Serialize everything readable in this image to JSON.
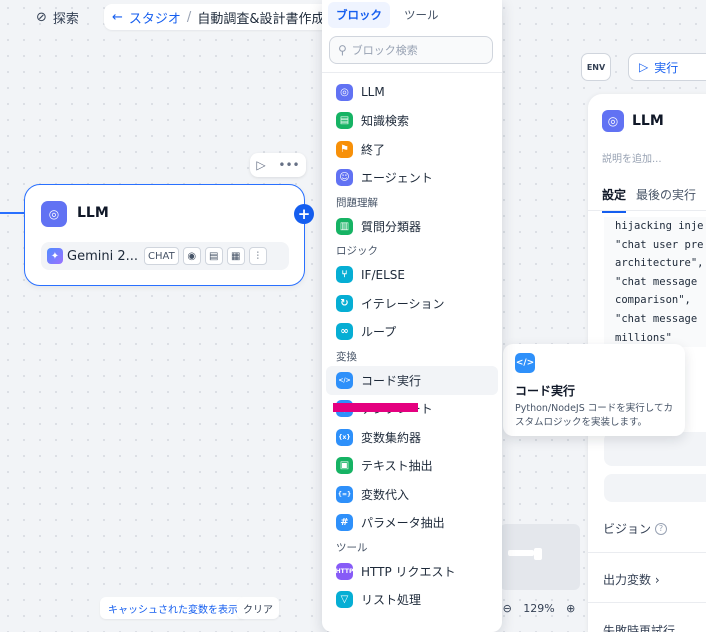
{
  "topbar": {
    "search_label": "探索",
    "studio_label": "スタジオ",
    "separator": "/",
    "app_title": "自動調査&設計書作成"
  },
  "node": {
    "title": "LLM",
    "model_name": "Gemini 2...",
    "mode_chip": "CHAT"
  },
  "canvas": {
    "cache_button": "キャッシュされた変数を表示",
    "clear_button": "クリア",
    "zoom_level": "129%"
  },
  "toolbar": {
    "env_label": "ENV",
    "run_label": "実行"
  },
  "panel": {
    "title": "LLM",
    "description_placeholder": "説明を追加...",
    "tabs": [
      "設定",
      "最後の実行"
    ],
    "code_lines": [
      "hijacking inje",
      "\"chat user pre",
      "architecture\",",
      "\"chat message",
      "comparison\",",
      "\"chat message",
      "millions\""
    ],
    "vision_label": "ビジョン",
    "output_vars_label": "出力変数",
    "truncated_label": "失敗時再試行"
  },
  "tooltip": {
    "title": "コード実行",
    "description": "Python/NodeJS コードを実行してカスタムロジックを実装します。"
  },
  "dropdown": {
    "tabs": [
      "ブロック",
      "ツール"
    ],
    "search_placeholder": "ブロック検索",
    "items": [
      {
        "type": "item",
        "label": "LLM",
        "icon": "llm-icon",
        "color": "#6172f3",
        "glyph": "◎"
      },
      {
        "type": "item",
        "label": "知識検索",
        "icon": "knowledge-icon",
        "color": "#16b364",
        "glyph": "▤"
      },
      {
        "type": "item",
        "label": "終了",
        "icon": "end-icon",
        "color": "#f79009",
        "glyph": "⚑"
      },
      {
        "type": "item",
        "label": "エージェント",
        "icon": "agent-icon",
        "color": "#6172f3",
        "glyph": "☺"
      },
      {
        "type": "group",
        "label": "問題理解"
      },
      {
        "type": "item",
        "label": "質問分類器",
        "icon": "classifier-icon",
        "color": "#16b364",
        "glyph": "▥"
      },
      {
        "type": "group",
        "label": "ロジック"
      },
      {
        "type": "item",
        "label": "IF/ELSE",
        "icon": "branch-icon",
        "color": "#06aed4",
        "glyph": "⑂"
      },
      {
        "type": "item",
        "label": "イテレーション",
        "icon": "iteration-icon",
        "color": "#06aed4",
        "glyph": "↻"
      },
      {
        "type": "item",
        "label": "ループ",
        "icon": "loop-icon",
        "color": "#06aed4",
        "glyph": "∞"
      },
      {
        "type": "group",
        "label": "変換"
      },
      {
        "type": "item",
        "label": "コード実行",
        "icon": "code-icon",
        "color": "#2e90fa",
        "glyph": "</>",
        "hover": true
      },
      {
        "type": "item",
        "label": "テンプレート",
        "icon": "template-icon",
        "color": "#2e90fa",
        "glyph": "◐"
      },
      {
        "type": "item",
        "label": "変数集約器",
        "icon": "variable-aggregator-icon",
        "color": "#2e90fa",
        "glyph": "{x}"
      },
      {
        "type": "item",
        "label": "テキスト抽出",
        "icon": "text-extract-icon",
        "color": "#16b364",
        "glyph": "▣"
      },
      {
        "type": "item",
        "label": "変数代入",
        "icon": "assign-icon",
        "color": "#2e90fa",
        "glyph": "{=}"
      },
      {
        "type": "item",
        "label": "パラメータ抽出",
        "icon": "parameter-icon",
        "color": "#2e90fa",
        "glyph": "#"
      },
      {
        "type": "group",
        "label": "ツール"
      },
      {
        "type": "item",
        "label": "HTTP リクエスト",
        "icon": "http-icon",
        "color": "#875bf7",
        "glyph": "HTTP"
      },
      {
        "type": "item",
        "label": "リスト処理",
        "icon": "list-icon",
        "color": "#06aed4",
        "glyph": "▽"
      }
    ]
  }
}
